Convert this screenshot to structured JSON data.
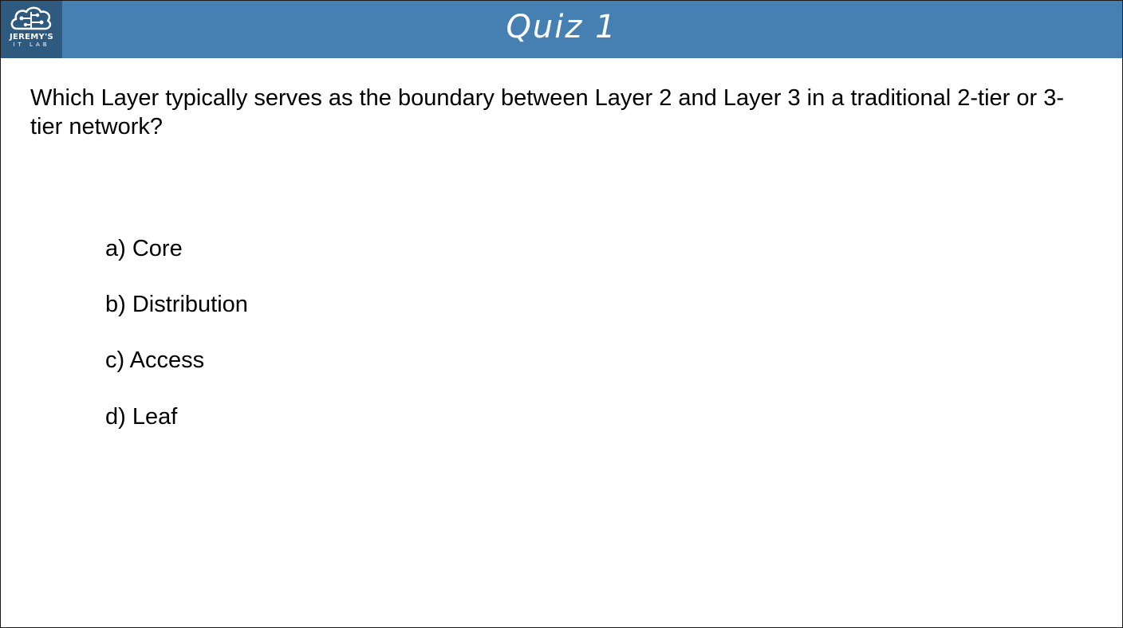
{
  "header": {
    "logo_name": "JEREMY'S",
    "logo_sub": "IT LAB",
    "title": "Quiz 1",
    "colors": {
      "bar": "#4680b2",
      "logo_bg": "#2f5a80"
    },
    "logo_icon": "brain-circuit-icon"
  },
  "question": {
    "text": "Which Layer typically serves as the boundary between Layer 2 and Layer 3 in a traditional 2-tier or 3-tier network?"
  },
  "options": [
    {
      "label": "a) Core"
    },
    {
      "label": "b) Distribution"
    },
    {
      "label": "c) Access"
    },
    {
      "label": "d) Leaf"
    }
  ]
}
